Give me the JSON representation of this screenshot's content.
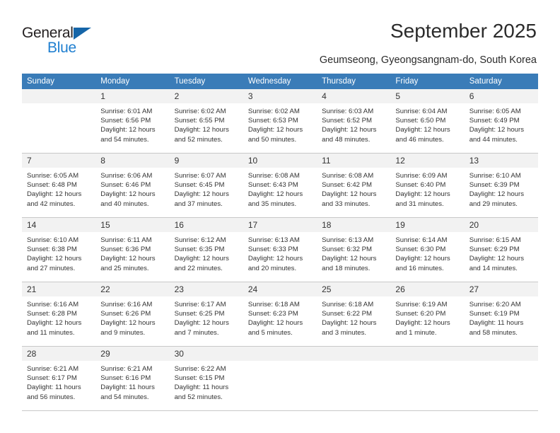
{
  "brand": {
    "name_part1": "General",
    "name_part2": "Blue",
    "accent_color": "#1f7fd0",
    "triangle_color": "#1565a8"
  },
  "header": {
    "title": "September 2025",
    "subtitle": "Geumseong, Gyeongsangnam-do, South Korea",
    "header_bg": "#3a7cb8"
  },
  "weekdays": [
    "Sunday",
    "Monday",
    "Tuesday",
    "Wednesday",
    "Thursday",
    "Friday",
    "Saturday"
  ],
  "weeks": [
    [
      {
        "day": "",
        "blank": true,
        "sunrise": "",
        "sunset": "",
        "daylight1": "",
        "daylight2": ""
      },
      {
        "day": "1",
        "sunrise": "Sunrise: 6:01 AM",
        "sunset": "Sunset: 6:56 PM",
        "daylight1": "Daylight: 12 hours",
        "daylight2": "and 54 minutes."
      },
      {
        "day": "2",
        "sunrise": "Sunrise: 6:02 AM",
        "sunset": "Sunset: 6:55 PM",
        "daylight1": "Daylight: 12 hours",
        "daylight2": "and 52 minutes."
      },
      {
        "day": "3",
        "sunrise": "Sunrise: 6:02 AM",
        "sunset": "Sunset: 6:53 PM",
        "daylight1": "Daylight: 12 hours",
        "daylight2": "and 50 minutes."
      },
      {
        "day": "4",
        "sunrise": "Sunrise: 6:03 AM",
        "sunset": "Sunset: 6:52 PM",
        "daylight1": "Daylight: 12 hours",
        "daylight2": "and 48 minutes."
      },
      {
        "day": "5",
        "sunrise": "Sunrise: 6:04 AM",
        "sunset": "Sunset: 6:50 PM",
        "daylight1": "Daylight: 12 hours",
        "daylight2": "and 46 minutes."
      },
      {
        "day": "6",
        "sunrise": "Sunrise: 6:05 AM",
        "sunset": "Sunset: 6:49 PM",
        "daylight1": "Daylight: 12 hours",
        "daylight2": "and 44 minutes."
      }
    ],
    [
      {
        "day": "7",
        "sunrise": "Sunrise: 6:05 AM",
        "sunset": "Sunset: 6:48 PM",
        "daylight1": "Daylight: 12 hours",
        "daylight2": "and 42 minutes."
      },
      {
        "day": "8",
        "sunrise": "Sunrise: 6:06 AM",
        "sunset": "Sunset: 6:46 PM",
        "daylight1": "Daylight: 12 hours",
        "daylight2": "and 40 minutes."
      },
      {
        "day": "9",
        "sunrise": "Sunrise: 6:07 AM",
        "sunset": "Sunset: 6:45 PM",
        "daylight1": "Daylight: 12 hours",
        "daylight2": "and 37 minutes."
      },
      {
        "day": "10",
        "sunrise": "Sunrise: 6:08 AM",
        "sunset": "Sunset: 6:43 PM",
        "daylight1": "Daylight: 12 hours",
        "daylight2": "and 35 minutes."
      },
      {
        "day": "11",
        "sunrise": "Sunrise: 6:08 AM",
        "sunset": "Sunset: 6:42 PM",
        "daylight1": "Daylight: 12 hours",
        "daylight2": "and 33 minutes."
      },
      {
        "day": "12",
        "sunrise": "Sunrise: 6:09 AM",
        "sunset": "Sunset: 6:40 PM",
        "daylight1": "Daylight: 12 hours",
        "daylight2": "and 31 minutes."
      },
      {
        "day": "13",
        "sunrise": "Sunrise: 6:10 AM",
        "sunset": "Sunset: 6:39 PM",
        "daylight1": "Daylight: 12 hours",
        "daylight2": "and 29 minutes."
      }
    ],
    [
      {
        "day": "14",
        "sunrise": "Sunrise: 6:10 AM",
        "sunset": "Sunset: 6:38 PM",
        "daylight1": "Daylight: 12 hours",
        "daylight2": "and 27 minutes."
      },
      {
        "day": "15",
        "sunrise": "Sunrise: 6:11 AM",
        "sunset": "Sunset: 6:36 PM",
        "daylight1": "Daylight: 12 hours",
        "daylight2": "and 25 minutes."
      },
      {
        "day": "16",
        "sunrise": "Sunrise: 6:12 AM",
        "sunset": "Sunset: 6:35 PM",
        "daylight1": "Daylight: 12 hours",
        "daylight2": "and 22 minutes."
      },
      {
        "day": "17",
        "sunrise": "Sunrise: 6:13 AM",
        "sunset": "Sunset: 6:33 PM",
        "daylight1": "Daylight: 12 hours",
        "daylight2": "and 20 minutes."
      },
      {
        "day": "18",
        "sunrise": "Sunrise: 6:13 AM",
        "sunset": "Sunset: 6:32 PM",
        "daylight1": "Daylight: 12 hours",
        "daylight2": "and 18 minutes."
      },
      {
        "day": "19",
        "sunrise": "Sunrise: 6:14 AM",
        "sunset": "Sunset: 6:30 PM",
        "daylight1": "Daylight: 12 hours",
        "daylight2": "and 16 minutes."
      },
      {
        "day": "20",
        "sunrise": "Sunrise: 6:15 AM",
        "sunset": "Sunset: 6:29 PM",
        "daylight1": "Daylight: 12 hours",
        "daylight2": "and 14 minutes."
      }
    ],
    [
      {
        "day": "21",
        "sunrise": "Sunrise: 6:16 AM",
        "sunset": "Sunset: 6:28 PM",
        "daylight1": "Daylight: 12 hours",
        "daylight2": "and 11 minutes."
      },
      {
        "day": "22",
        "sunrise": "Sunrise: 6:16 AM",
        "sunset": "Sunset: 6:26 PM",
        "daylight1": "Daylight: 12 hours",
        "daylight2": "and 9 minutes."
      },
      {
        "day": "23",
        "sunrise": "Sunrise: 6:17 AM",
        "sunset": "Sunset: 6:25 PM",
        "daylight1": "Daylight: 12 hours",
        "daylight2": "and 7 minutes."
      },
      {
        "day": "24",
        "sunrise": "Sunrise: 6:18 AM",
        "sunset": "Sunset: 6:23 PM",
        "daylight1": "Daylight: 12 hours",
        "daylight2": "and 5 minutes."
      },
      {
        "day": "25",
        "sunrise": "Sunrise: 6:18 AM",
        "sunset": "Sunset: 6:22 PM",
        "daylight1": "Daylight: 12 hours",
        "daylight2": "and 3 minutes."
      },
      {
        "day": "26",
        "sunrise": "Sunrise: 6:19 AM",
        "sunset": "Sunset: 6:20 PM",
        "daylight1": "Daylight: 12 hours",
        "daylight2": "and 1 minute."
      },
      {
        "day": "27",
        "sunrise": "Sunrise: 6:20 AM",
        "sunset": "Sunset: 6:19 PM",
        "daylight1": "Daylight: 11 hours",
        "daylight2": "and 58 minutes."
      }
    ],
    [
      {
        "day": "28",
        "sunrise": "Sunrise: 6:21 AM",
        "sunset": "Sunset: 6:17 PM",
        "daylight1": "Daylight: 11 hours",
        "daylight2": "and 56 minutes."
      },
      {
        "day": "29",
        "sunrise": "Sunrise: 6:21 AM",
        "sunset": "Sunset: 6:16 PM",
        "daylight1": "Daylight: 11 hours",
        "daylight2": "and 54 minutes."
      },
      {
        "day": "30",
        "sunrise": "Sunrise: 6:22 AM",
        "sunset": "Sunset: 6:15 PM",
        "daylight1": "Daylight: 11 hours",
        "daylight2": "and 52 minutes."
      },
      {
        "day": "",
        "blank": true,
        "sunrise": "",
        "sunset": "",
        "daylight1": "",
        "daylight2": ""
      },
      {
        "day": "",
        "blank": true,
        "sunrise": "",
        "sunset": "",
        "daylight1": "",
        "daylight2": ""
      },
      {
        "day": "",
        "blank": true,
        "sunrise": "",
        "sunset": "",
        "daylight1": "",
        "daylight2": ""
      },
      {
        "day": "",
        "blank": true,
        "sunrise": "",
        "sunset": "",
        "daylight1": "",
        "daylight2": ""
      }
    ]
  ]
}
